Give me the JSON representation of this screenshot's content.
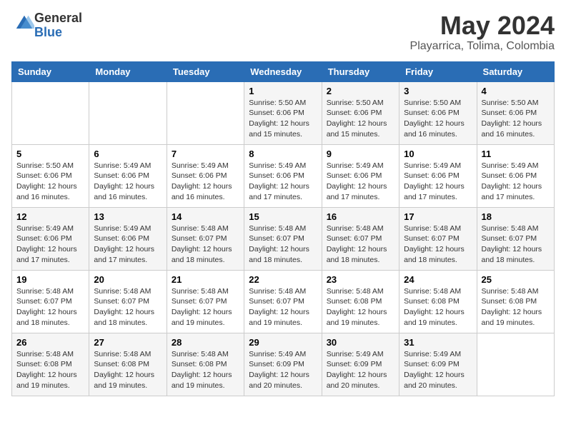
{
  "header": {
    "logo_general": "General",
    "logo_blue": "Blue",
    "month_year": "May 2024",
    "location": "Playarrica, Tolima, Colombia"
  },
  "weekdays": [
    "Sunday",
    "Monday",
    "Tuesday",
    "Wednesday",
    "Thursday",
    "Friday",
    "Saturday"
  ],
  "weeks": [
    [
      {
        "day": "",
        "info": ""
      },
      {
        "day": "",
        "info": ""
      },
      {
        "day": "",
        "info": ""
      },
      {
        "day": "1",
        "info": "Sunrise: 5:50 AM\nSunset: 6:06 PM\nDaylight: 12 hours\nand 15 minutes."
      },
      {
        "day": "2",
        "info": "Sunrise: 5:50 AM\nSunset: 6:06 PM\nDaylight: 12 hours\nand 15 minutes."
      },
      {
        "day": "3",
        "info": "Sunrise: 5:50 AM\nSunset: 6:06 PM\nDaylight: 12 hours\nand 16 minutes."
      },
      {
        "day": "4",
        "info": "Sunrise: 5:50 AM\nSunset: 6:06 PM\nDaylight: 12 hours\nand 16 minutes."
      }
    ],
    [
      {
        "day": "5",
        "info": "Sunrise: 5:50 AM\nSunset: 6:06 PM\nDaylight: 12 hours\nand 16 minutes."
      },
      {
        "day": "6",
        "info": "Sunrise: 5:49 AM\nSunset: 6:06 PM\nDaylight: 12 hours\nand 16 minutes."
      },
      {
        "day": "7",
        "info": "Sunrise: 5:49 AM\nSunset: 6:06 PM\nDaylight: 12 hours\nand 16 minutes."
      },
      {
        "day": "8",
        "info": "Sunrise: 5:49 AM\nSunset: 6:06 PM\nDaylight: 12 hours\nand 17 minutes."
      },
      {
        "day": "9",
        "info": "Sunrise: 5:49 AM\nSunset: 6:06 PM\nDaylight: 12 hours\nand 17 minutes."
      },
      {
        "day": "10",
        "info": "Sunrise: 5:49 AM\nSunset: 6:06 PM\nDaylight: 12 hours\nand 17 minutes."
      },
      {
        "day": "11",
        "info": "Sunrise: 5:49 AM\nSunset: 6:06 PM\nDaylight: 12 hours\nand 17 minutes."
      }
    ],
    [
      {
        "day": "12",
        "info": "Sunrise: 5:49 AM\nSunset: 6:06 PM\nDaylight: 12 hours\nand 17 minutes."
      },
      {
        "day": "13",
        "info": "Sunrise: 5:49 AM\nSunset: 6:06 PM\nDaylight: 12 hours\nand 17 minutes."
      },
      {
        "day": "14",
        "info": "Sunrise: 5:48 AM\nSunset: 6:07 PM\nDaylight: 12 hours\nand 18 minutes."
      },
      {
        "day": "15",
        "info": "Sunrise: 5:48 AM\nSunset: 6:07 PM\nDaylight: 12 hours\nand 18 minutes."
      },
      {
        "day": "16",
        "info": "Sunrise: 5:48 AM\nSunset: 6:07 PM\nDaylight: 12 hours\nand 18 minutes."
      },
      {
        "day": "17",
        "info": "Sunrise: 5:48 AM\nSunset: 6:07 PM\nDaylight: 12 hours\nand 18 minutes."
      },
      {
        "day": "18",
        "info": "Sunrise: 5:48 AM\nSunset: 6:07 PM\nDaylight: 12 hours\nand 18 minutes."
      }
    ],
    [
      {
        "day": "19",
        "info": "Sunrise: 5:48 AM\nSunset: 6:07 PM\nDaylight: 12 hours\nand 18 minutes."
      },
      {
        "day": "20",
        "info": "Sunrise: 5:48 AM\nSunset: 6:07 PM\nDaylight: 12 hours\nand 18 minutes."
      },
      {
        "day": "21",
        "info": "Sunrise: 5:48 AM\nSunset: 6:07 PM\nDaylight: 12 hours\nand 19 minutes."
      },
      {
        "day": "22",
        "info": "Sunrise: 5:48 AM\nSunset: 6:07 PM\nDaylight: 12 hours\nand 19 minutes."
      },
      {
        "day": "23",
        "info": "Sunrise: 5:48 AM\nSunset: 6:08 PM\nDaylight: 12 hours\nand 19 minutes."
      },
      {
        "day": "24",
        "info": "Sunrise: 5:48 AM\nSunset: 6:08 PM\nDaylight: 12 hours\nand 19 minutes."
      },
      {
        "day": "25",
        "info": "Sunrise: 5:48 AM\nSunset: 6:08 PM\nDaylight: 12 hours\nand 19 minutes."
      }
    ],
    [
      {
        "day": "26",
        "info": "Sunrise: 5:48 AM\nSunset: 6:08 PM\nDaylight: 12 hours\nand 19 minutes."
      },
      {
        "day": "27",
        "info": "Sunrise: 5:48 AM\nSunset: 6:08 PM\nDaylight: 12 hours\nand 19 minutes."
      },
      {
        "day": "28",
        "info": "Sunrise: 5:48 AM\nSunset: 6:08 PM\nDaylight: 12 hours\nand 19 minutes."
      },
      {
        "day": "29",
        "info": "Sunrise: 5:49 AM\nSunset: 6:09 PM\nDaylight: 12 hours\nand 20 minutes."
      },
      {
        "day": "30",
        "info": "Sunrise: 5:49 AM\nSunset: 6:09 PM\nDaylight: 12 hours\nand 20 minutes."
      },
      {
        "day": "31",
        "info": "Sunrise: 5:49 AM\nSunset: 6:09 PM\nDaylight: 12 hours\nand 20 minutes."
      },
      {
        "day": "",
        "info": ""
      }
    ]
  ]
}
